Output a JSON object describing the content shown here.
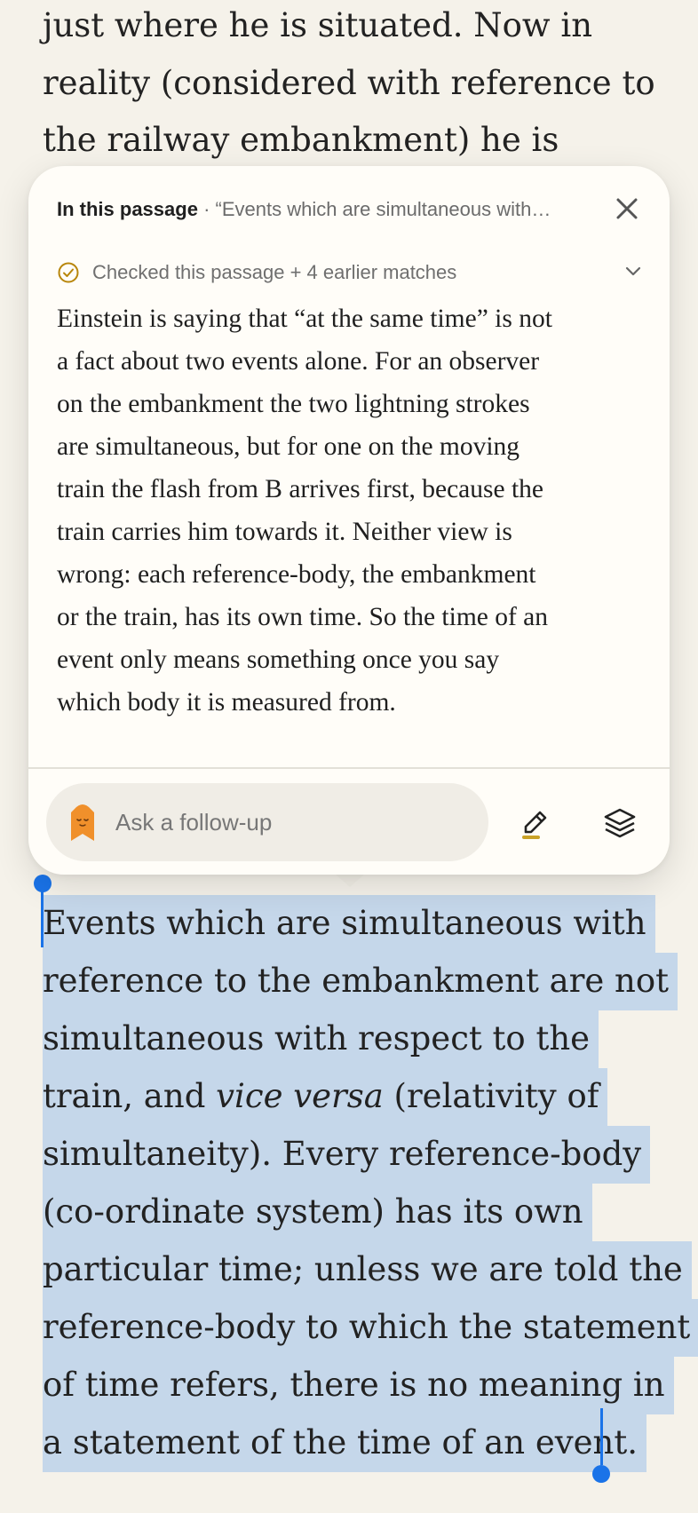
{
  "book": {
    "top_lines": [
      "just where he is situated. Now in",
      "reality (considered with reference to",
      "the railway embankment) he is"
    ],
    "selection_lines": [
      "Events which are simultaneous with",
      "reference to the embankment are not",
      "simultaneous with respect to the",
      "vice versa",
      "simultaneity). Every reference-body",
      "(co-ordinate system) has its own",
      "particular time; unless we are told the",
      "reference-body to which the statement",
      "of time refers, there is no meaning in",
      "a statement of the time of an event."
    ],
    "line4_before": "train, and ",
    "line4_italic": "vice versa",
    "line4_after": " (relativity of"
  },
  "card": {
    "header_lead": "In this passage",
    "header_quote": " · “Events which are simultaneous with…",
    "checked_label": "Checked this passage + 4 earlier matches",
    "answer_lines": [
      "Einstein is saying that “at the same time” is not",
      "a fact about two events alone. For an observer",
      "on the embankment the two lightning strokes",
      "are simultaneous, but for one on the moving",
      "train the flash from B arrives first, because the",
      "train carries him towards it. Neither view is",
      "wrong: each reference-body, the embankment",
      "or the train, has its own time. So the time of an",
      "event only means something once you say",
      "which body it is measured from."
    ],
    "followup_placeholder": "Ask a follow-up"
  },
  "colors": {
    "selection": "#c5d7ea",
    "handle": "#1a73e8",
    "mascot": "#f0902b",
    "highlight_underline": "#c9a227"
  },
  "icons": [
    "close-icon",
    "check-circle-icon",
    "chevron-down-icon",
    "mascot-icon",
    "highlighter-icon",
    "layers-icon"
  ]
}
